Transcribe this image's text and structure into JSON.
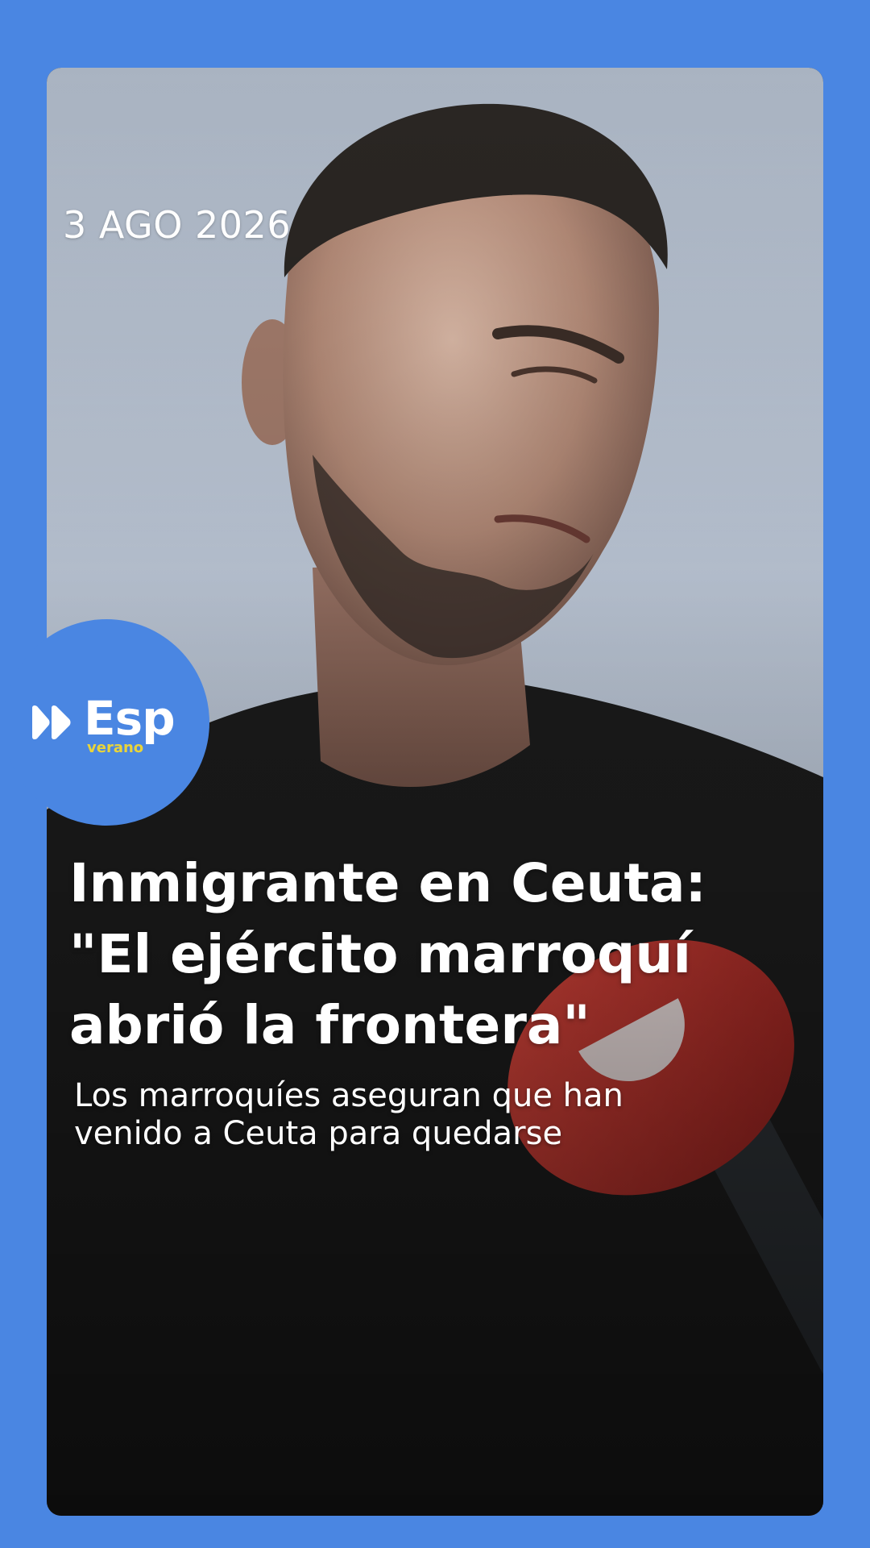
{
  "story": {
    "date": "3 AGO 2026",
    "headline": "Inmigrante en Ceuta: \"El ejército marroquí abrió la frontera\"",
    "subtitle": "Los marroquíes aseguran que han venido a Ceuta para quedarse"
  },
  "badge": {
    "brand": "Esp",
    "season": "verano",
    "icon": "double-play-icon"
  },
  "colors": {
    "background": "#4a86e2",
    "badge": "#4a86e2",
    "season_text": "#e9d43a",
    "microphone": "#c0392b"
  }
}
